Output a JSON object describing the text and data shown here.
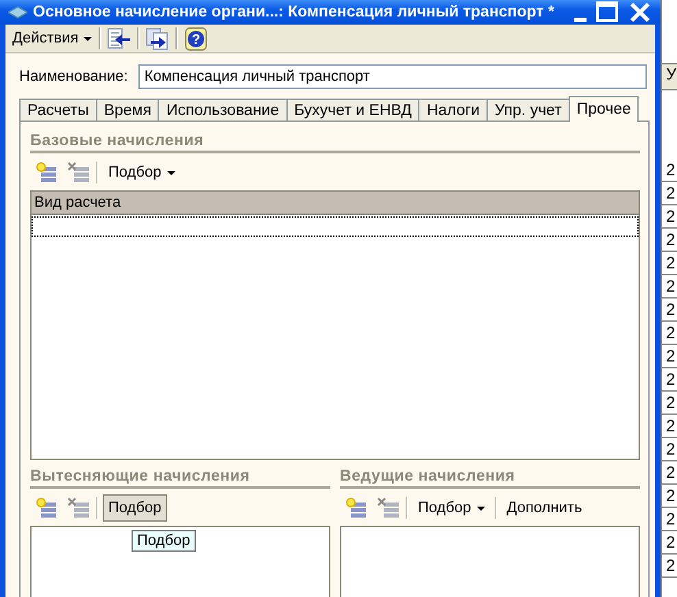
{
  "window": {
    "title": "Основное начисление органи...: Компенсация личный транспорт *"
  },
  "toolbar": {
    "actions_menu": "Действия",
    "help_label": "?"
  },
  "name_field": {
    "label": "Наименование:",
    "value": "Компенсация личный транспорт"
  },
  "tabs": [
    {
      "label": "Расчеты",
      "selected": false
    },
    {
      "label": "Время",
      "selected": false
    },
    {
      "label": "Использование",
      "selected": false
    },
    {
      "label": "Бухучет и ЕНВД",
      "selected": false
    },
    {
      "label": "Налоги",
      "selected": false
    },
    {
      "label": "Упр. учет",
      "selected": false
    },
    {
      "label": "Прочее",
      "selected": true
    }
  ],
  "sections": [
    {
      "title": "Базовые начисления",
      "buttons": [
        {
          "kind": "add"
        },
        {
          "kind": "delete"
        },
        {
          "kind": "menu",
          "label": "Подбор",
          "pressed": false
        }
      ],
      "table": {
        "columns": [
          "Вид расчета"
        ],
        "has_focus_row": true
      }
    },
    {
      "title": "Вытесняющие начисления",
      "buttons": [
        {
          "kind": "add"
        },
        {
          "kind": "delete"
        },
        {
          "kind": "button",
          "label": "Подбор",
          "pressed": true
        }
      ],
      "tooltip": "Подбор"
    },
    {
      "title": "Ведущие начисления",
      "buttons": [
        {
          "kind": "add"
        },
        {
          "kind": "delete"
        },
        {
          "kind": "menu",
          "label": "Подбор",
          "pressed": false
        },
        {
          "kind": "button",
          "label": "Дополнить",
          "pressed": false
        }
      ]
    }
  ],
  "background_table": {
    "column_1": "У",
    "rows": [
      "2",
      "2",
      "2",
      "2",
      "2",
      "2",
      "2",
      "2",
      "2",
      "2",
      "2",
      "2",
      "2",
      "2",
      "2",
      "2",
      "2",
      "2"
    ]
  }
}
